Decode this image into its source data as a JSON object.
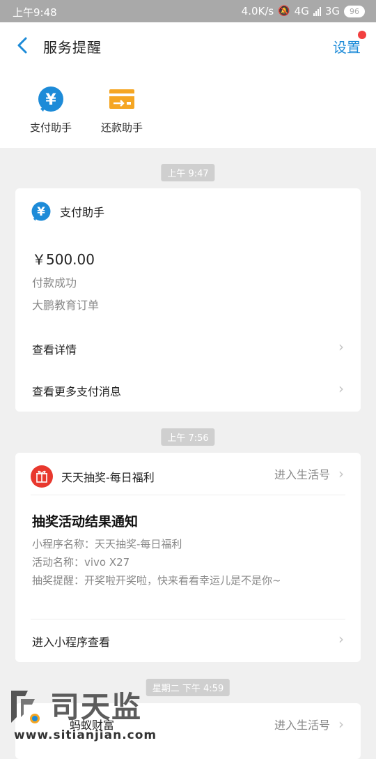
{
  "status_bar": {
    "time": "上午9:48",
    "speed": "4.0K/s",
    "network1": "4G",
    "network2": "3G",
    "battery": "96"
  },
  "header": {
    "title": "服务提醒",
    "settings_label": "设置"
  },
  "shortcuts": [
    {
      "label": "支付助手",
      "icon": "yuan-icon",
      "color": "#1d8bd8"
    },
    {
      "label": "还款助手",
      "icon": "card-transfer-icon",
      "color": "#f5a623"
    }
  ],
  "feed": [
    {
      "timestamp": "上午 9:47",
      "source": "支付助手",
      "amount": "￥500.00",
      "lines": [
        "付款成功",
        "大鹏教育订单"
      ],
      "links": [
        "查看详情",
        "查看更多支付消息"
      ]
    },
    {
      "timestamp": "上午 7:56",
      "source": "天天抽奖-每日福利",
      "enter_label": "进入生活号",
      "headline": "抽奖活动结果通知",
      "lines": [
        "小程序名称：天天抽奖-每日福利",
        "活动名称：vivo X27",
        "抽奖提醒：开奖啦开奖啦，快来看看幸运儿是不是你~"
      ],
      "links": [
        "进入小程序查看"
      ]
    },
    {
      "timestamp": "星期二 下午 4:59",
      "source": "蚂蚁财富",
      "enter_label": "进入生活号"
    }
  ],
  "watermark": {
    "brand": "司天监",
    "url": "www.sitianjian.com"
  },
  "colors": {
    "accent": "#1d8bd8",
    "badge": "#f24040",
    "gift": "#e8382e"
  }
}
